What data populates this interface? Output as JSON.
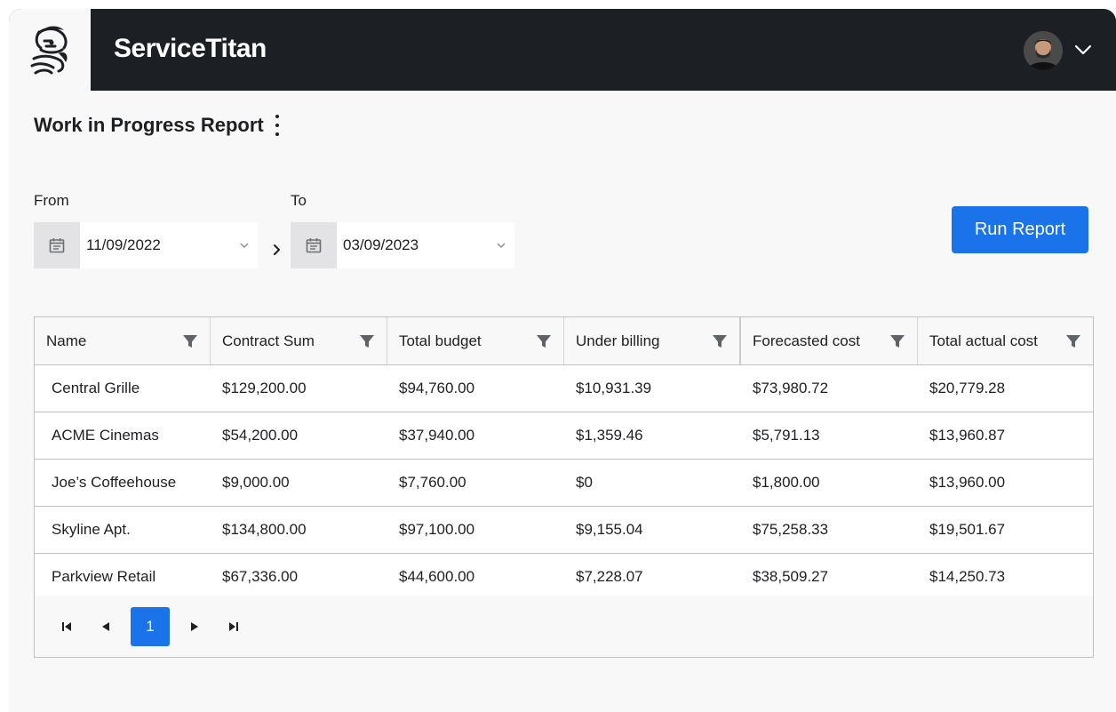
{
  "header": {
    "brand": "ServiceTitan",
    "logo_icon": "titan-mascot-logo",
    "avatar_icon": "user-avatar",
    "menu_icon": "chevron-down-icon"
  },
  "page": {
    "title": "Work in Progress Report",
    "menu_icon": "kebab-menu-icon"
  },
  "filters": {
    "from_label": "From",
    "from_value": "11/09/2022",
    "to_label": "To",
    "to_value": "03/09/2023",
    "separator_icon": "chevron-right-icon",
    "calendar_icon": "calendar-icon"
  },
  "actions": {
    "run_report_label": "Run Report"
  },
  "table": {
    "columns": [
      "Name",
      "Contract Sum",
      "Total budget",
      "Under billing",
      "Forecasted cost",
      "Total actual cost"
    ],
    "rows": [
      [
        "Central Grille",
        "$129,200.00",
        "$94,760.00",
        "$10,931.39",
        "$73,980.72",
        "$20,779.28"
      ],
      [
        "ACME Cinemas",
        "$54,200.00",
        "$37,940.00",
        "$1,359.46",
        "$5,791.13",
        "$13,960.87"
      ],
      [
        "Joe’s Coffeehouse",
        "$9,000.00",
        "$7,760.00",
        "$0",
        "$1,800.00",
        "$13,960.00"
      ],
      [
        "Skyline Apt.",
        "$134,800.00",
        "$97,100.00",
        "$9,155.04",
        "$75,258.33",
        "$19,501.67"
      ],
      [
        "Parkview Retail",
        "$67,336.00",
        "$44,600.00",
        "$7,228.07",
        "$38,509.27",
        "$14,250.73"
      ]
    ]
  },
  "pagination": {
    "current_page": "1",
    "first_icon": "first-page-icon",
    "prev_icon": "prev-page-icon",
    "next_icon": "next-page-icon",
    "last_icon": "last-page-icon"
  },
  "colors": {
    "header_bg": "#1c1f23",
    "accent": "#1a73e8",
    "page_bg": "#f8f8f8"
  }
}
